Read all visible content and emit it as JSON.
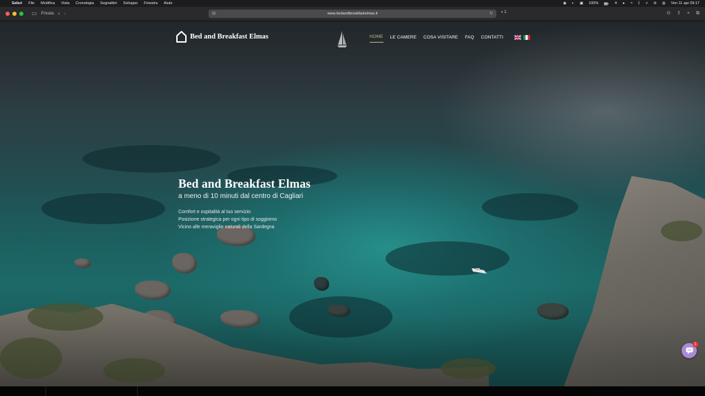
{
  "menubar": {
    "app_name": "Safari",
    "items": [
      "File",
      "Modifica",
      "Vista",
      "Cronologia",
      "Segnalibri",
      "Sviluppo",
      "Finestra",
      "Aiuto"
    ],
    "battery": "100%",
    "datetime": "Ven 11 apr  09:17"
  },
  "browser": {
    "private_label": "Privata",
    "url": "www.bedandbreakfastelmas.it",
    "tab_count": "1"
  },
  "site": {
    "logo_text": "Bed and Breakfast Elmas",
    "nav": [
      {
        "label": "HOME",
        "active": true
      },
      {
        "label": "LE CAMERE"
      },
      {
        "label": "COSA VISITARE"
      },
      {
        "label": "FAQ"
      },
      {
        "label": "CONTATTI"
      }
    ],
    "languages": [
      "English",
      "Italiano"
    ]
  },
  "hero": {
    "title": "Bed and Breakfast Elmas",
    "subtitle": "a meno di 10 minuti dal centro di Cagliari",
    "features": [
      "Comfort e ospitalità al tuo servizio",
      "Posizione strategica per ogni tipo di soggiorno",
      "Vicino alle meraviglie naturali della Sardegna"
    ]
  },
  "chat": {
    "badge_count": "1"
  },
  "colors": {
    "nav_active": "#c9b48a",
    "chat_bubble": "#a88bd6",
    "badge": "#e53935"
  }
}
